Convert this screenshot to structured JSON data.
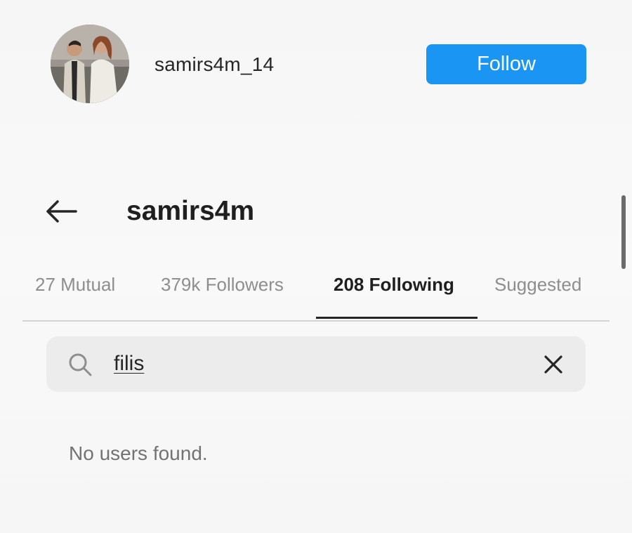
{
  "suggested_account": {
    "username": "samirs4m_14",
    "follow_label": "Follow",
    "follow_color": "#1a95f3"
  },
  "header": {
    "profile_name": "samirs4m",
    "back_icon": "arrow-left-icon"
  },
  "tabs": [
    {
      "label": "27 Mutual",
      "active": false
    },
    {
      "label": "379k Followers",
      "active": false
    },
    {
      "label": "208 Following",
      "active": true
    },
    {
      "label": "Suggested",
      "active": false
    }
  ],
  "search": {
    "icon": "search-icon",
    "value": "filis",
    "clear_icon": "close-icon"
  },
  "results": {
    "empty_message": "No users found."
  }
}
